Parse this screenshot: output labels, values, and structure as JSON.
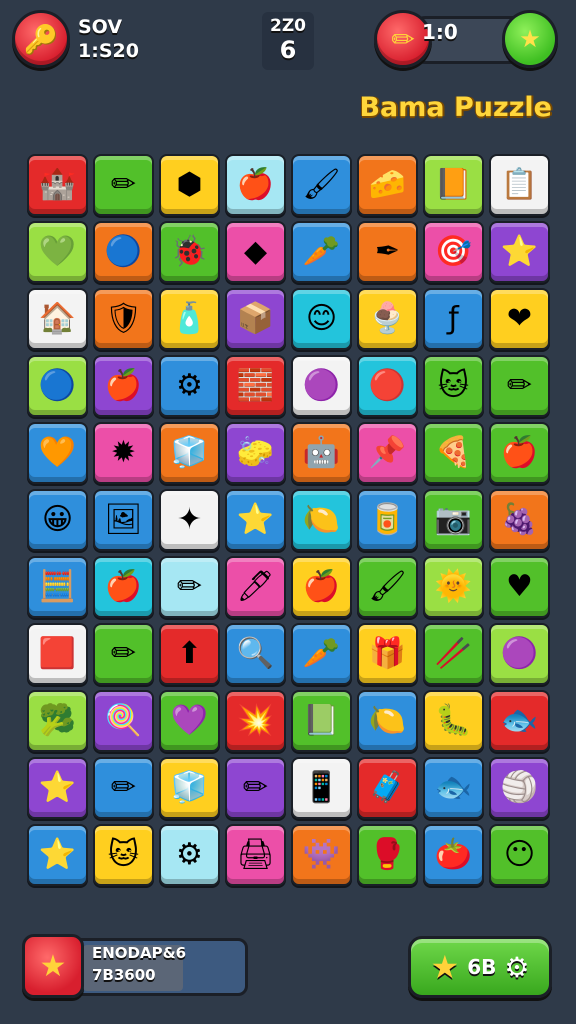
{
  "hud": {
    "left_line1": "SOV",
    "left_line2": "1:S20",
    "center_top": "2Z0",
    "center_bottom": "6",
    "right_value": "1:0"
  },
  "title": "Bama Puzzle",
  "bottom": {
    "left_line1": "ENODAP&6",
    "left_line2": "7B3600",
    "right_label": "6B"
  },
  "icons": {
    "left_button": "key-icon",
    "right_red_button": "pencil-icon",
    "right_green_button": "star-icon",
    "bottom_left_button": "star-icon",
    "bottom_right_star": "star-icon",
    "bottom_right_gear": "gear-icon"
  },
  "colors": {
    "background": "#2f3a49",
    "title": "#ffd63b",
    "red": "#e42a2a",
    "green": "#52c02a",
    "yellow": "#ffcf1f",
    "cyan": "#23c4dc",
    "blue": "#2f8fdc",
    "orange": "#f2751b",
    "pink": "#ec4fa8",
    "purple": "#8e46d1",
    "white": "#f3f3f3",
    "lightcyan": "#a6e7f3",
    "lime": "#9adf44"
  },
  "tiles": [
    [
      {
        "c": "red",
        "g": "🏰",
        "n": "castle"
      },
      {
        "c": "green",
        "g": "✏",
        "n": "pencil"
      },
      {
        "c": "yellow",
        "g": "⬢",
        "n": "hexagon"
      },
      {
        "c": "lightcyan",
        "g": "🍎",
        "n": "apple"
      },
      {
        "c": "blue",
        "g": "🖌",
        "n": "brush"
      },
      {
        "c": "orange",
        "g": "🧀",
        "n": "cheese"
      },
      {
        "c": "lime",
        "g": "📙",
        "n": "book"
      },
      {
        "c": "white",
        "g": "📋",
        "n": "clipboard"
      }
    ],
    [
      {
        "c": "lime",
        "g": "💚",
        "n": "heart"
      },
      {
        "c": "orange",
        "g": "🔵",
        "n": "ring"
      },
      {
        "c": "green",
        "g": "🐞",
        "n": "bug"
      },
      {
        "c": "pink",
        "g": "◆",
        "n": "diamond"
      },
      {
        "c": "blue",
        "g": "🥕",
        "n": "carrot"
      },
      {
        "c": "orange",
        "g": "✒",
        "n": "pen"
      },
      {
        "c": "pink",
        "g": "🎯",
        "n": "target"
      },
      {
        "c": "purple",
        "g": "⭐",
        "n": "star"
      }
    ],
    [
      {
        "c": "white",
        "g": "🏠",
        "n": "house"
      },
      {
        "c": "orange",
        "g": "🛡",
        "n": "shield"
      },
      {
        "c": "yellow",
        "g": "🧴",
        "n": "bottle"
      },
      {
        "c": "purple",
        "g": "📦",
        "n": "box"
      },
      {
        "c": "cyan",
        "g": "😊",
        "n": "smiley"
      },
      {
        "c": "yellow",
        "g": "🍨",
        "n": "ice-cream"
      },
      {
        "c": "blue",
        "g": "ƒ",
        "n": "letter-f"
      },
      {
        "c": "yellow",
        "g": "❤",
        "n": "heart"
      }
    ],
    [
      {
        "c": "lime",
        "g": "🔵",
        "n": "donut"
      },
      {
        "c": "purple",
        "g": "🍎",
        "n": "apple"
      },
      {
        "c": "blue",
        "g": "⚙",
        "n": "gear"
      },
      {
        "c": "red",
        "g": "🧱",
        "n": "brick"
      },
      {
        "c": "white",
        "g": "🟣",
        "n": "balloon"
      },
      {
        "c": "cyan",
        "g": "🔴",
        "n": "ball"
      },
      {
        "c": "green",
        "g": "🐱",
        "n": "cat"
      },
      {
        "c": "green",
        "g": "✏",
        "n": "pencil"
      }
    ],
    [
      {
        "c": "blue",
        "g": "🧡",
        "n": "leaf"
      },
      {
        "c": "pink",
        "g": "✹",
        "n": "burst"
      },
      {
        "c": "orange",
        "g": "🧊",
        "n": "cube"
      },
      {
        "c": "purple",
        "g": "🧽",
        "n": "sponge"
      },
      {
        "c": "orange",
        "g": "🤖",
        "n": "robot"
      },
      {
        "c": "pink",
        "g": "📌",
        "n": "pin"
      },
      {
        "c": "green",
        "g": "🍕",
        "n": "pizza"
      },
      {
        "c": "green",
        "g": "🍎",
        "n": "apple"
      }
    ],
    [
      {
        "c": "blue",
        "g": "😀",
        "n": "face"
      },
      {
        "c": "blue",
        "g": "🖼",
        "n": "picture"
      },
      {
        "c": "white",
        "g": "✦",
        "n": "sparkle"
      },
      {
        "c": "blue",
        "g": "⭐",
        "n": "star"
      },
      {
        "c": "cyan",
        "g": "🍋",
        "n": "lemon"
      },
      {
        "c": "blue",
        "g": "🥫",
        "n": "can"
      },
      {
        "c": "green",
        "g": "📷",
        "n": "camera"
      },
      {
        "c": "orange",
        "g": "🍇",
        "n": "grapes"
      }
    ],
    [
      {
        "c": "blue",
        "g": "🧮",
        "n": "calendar"
      },
      {
        "c": "cyan",
        "g": "🍎",
        "n": "apple"
      },
      {
        "c": "lightcyan",
        "g": "✏",
        "n": "pencil"
      },
      {
        "c": "pink",
        "g": "🖊",
        "n": "pen"
      },
      {
        "c": "yellow",
        "g": "🍎",
        "n": "apple"
      },
      {
        "c": "green",
        "g": "🖌",
        "n": "brush"
      },
      {
        "c": "lime",
        "g": "🌞",
        "n": "sun"
      },
      {
        "c": "green",
        "g": "♥",
        "n": "heart"
      }
    ],
    [
      {
        "c": "white",
        "g": "🟥",
        "n": "cube"
      },
      {
        "c": "green",
        "g": "✏",
        "n": "pencil"
      },
      {
        "c": "red",
        "g": "⬆",
        "n": "arrow"
      },
      {
        "c": "blue",
        "g": "🔍",
        "n": "magnifier"
      },
      {
        "c": "blue",
        "g": "🥕",
        "n": "carrot"
      },
      {
        "c": "yellow",
        "g": "🎁",
        "n": "gift"
      },
      {
        "c": "green",
        "g": "🥢",
        "n": "stick"
      },
      {
        "c": "lime",
        "g": "🟣",
        "n": "donut"
      }
    ],
    [
      {
        "c": "lime",
        "g": "🥦",
        "n": "broccoli"
      },
      {
        "c": "purple",
        "g": "🍭",
        "n": "candy"
      },
      {
        "c": "green",
        "g": "💜",
        "n": "heart"
      },
      {
        "c": "red",
        "g": "💥",
        "n": "splat"
      },
      {
        "c": "green",
        "g": "📗",
        "n": "book"
      },
      {
        "c": "blue",
        "g": "🍋",
        "n": "lemon"
      },
      {
        "c": "yellow",
        "g": "🐛",
        "n": "worm"
      },
      {
        "c": "red",
        "g": "🐟",
        "n": "fish"
      }
    ],
    [
      {
        "c": "purple",
        "g": "⭐",
        "n": "star"
      },
      {
        "c": "blue",
        "g": "✏",
        "n": "pencil"
      },
      {
        "c": "yellow",
        "g": "🧊",
        "n": "cube"
      },
      {
        "c": "purple",
        "g": "✏",
        "n": "pencil"
      },
      {
        "c": "white",
        "g": "📱",
        "n": "phone"
      },
      {
        "c": "red",
        "g": "🧳",
        "n": "case"
      },
      {
        "c": "blue",
        "g": "🐟",
        "n": "fish"
      },
      {
        "c": "purple",
        "g": "🏐",
        "n": "ball"
      }
    ],
    [
      {
        "c": "blue",
        "g": "⭐",
        "n": "star"
      },
      {
        "c": "yellow",
        "g": "🐱",
        "n": "cat"
      },
      {
        "c": "lightcyan",
        "g": "⚙",
        "n": "gear"
      },
      {
        "c": "pink",
        "g": "🖨",
        "n": "printer"
      },
      {
        "c": "orange",
        "g": "👾",
        "n": "monster"
      },
      {
        "c": "green",
        "g": "🥊",
        "n": "glove"
      },
      {
        "c": "blue",
        "g": "🍅",
        "n": "tomato"
      },
      {
        "c": "green",
        "g": "😶",
        "n": "face"
      }
    ]
  ]
}
